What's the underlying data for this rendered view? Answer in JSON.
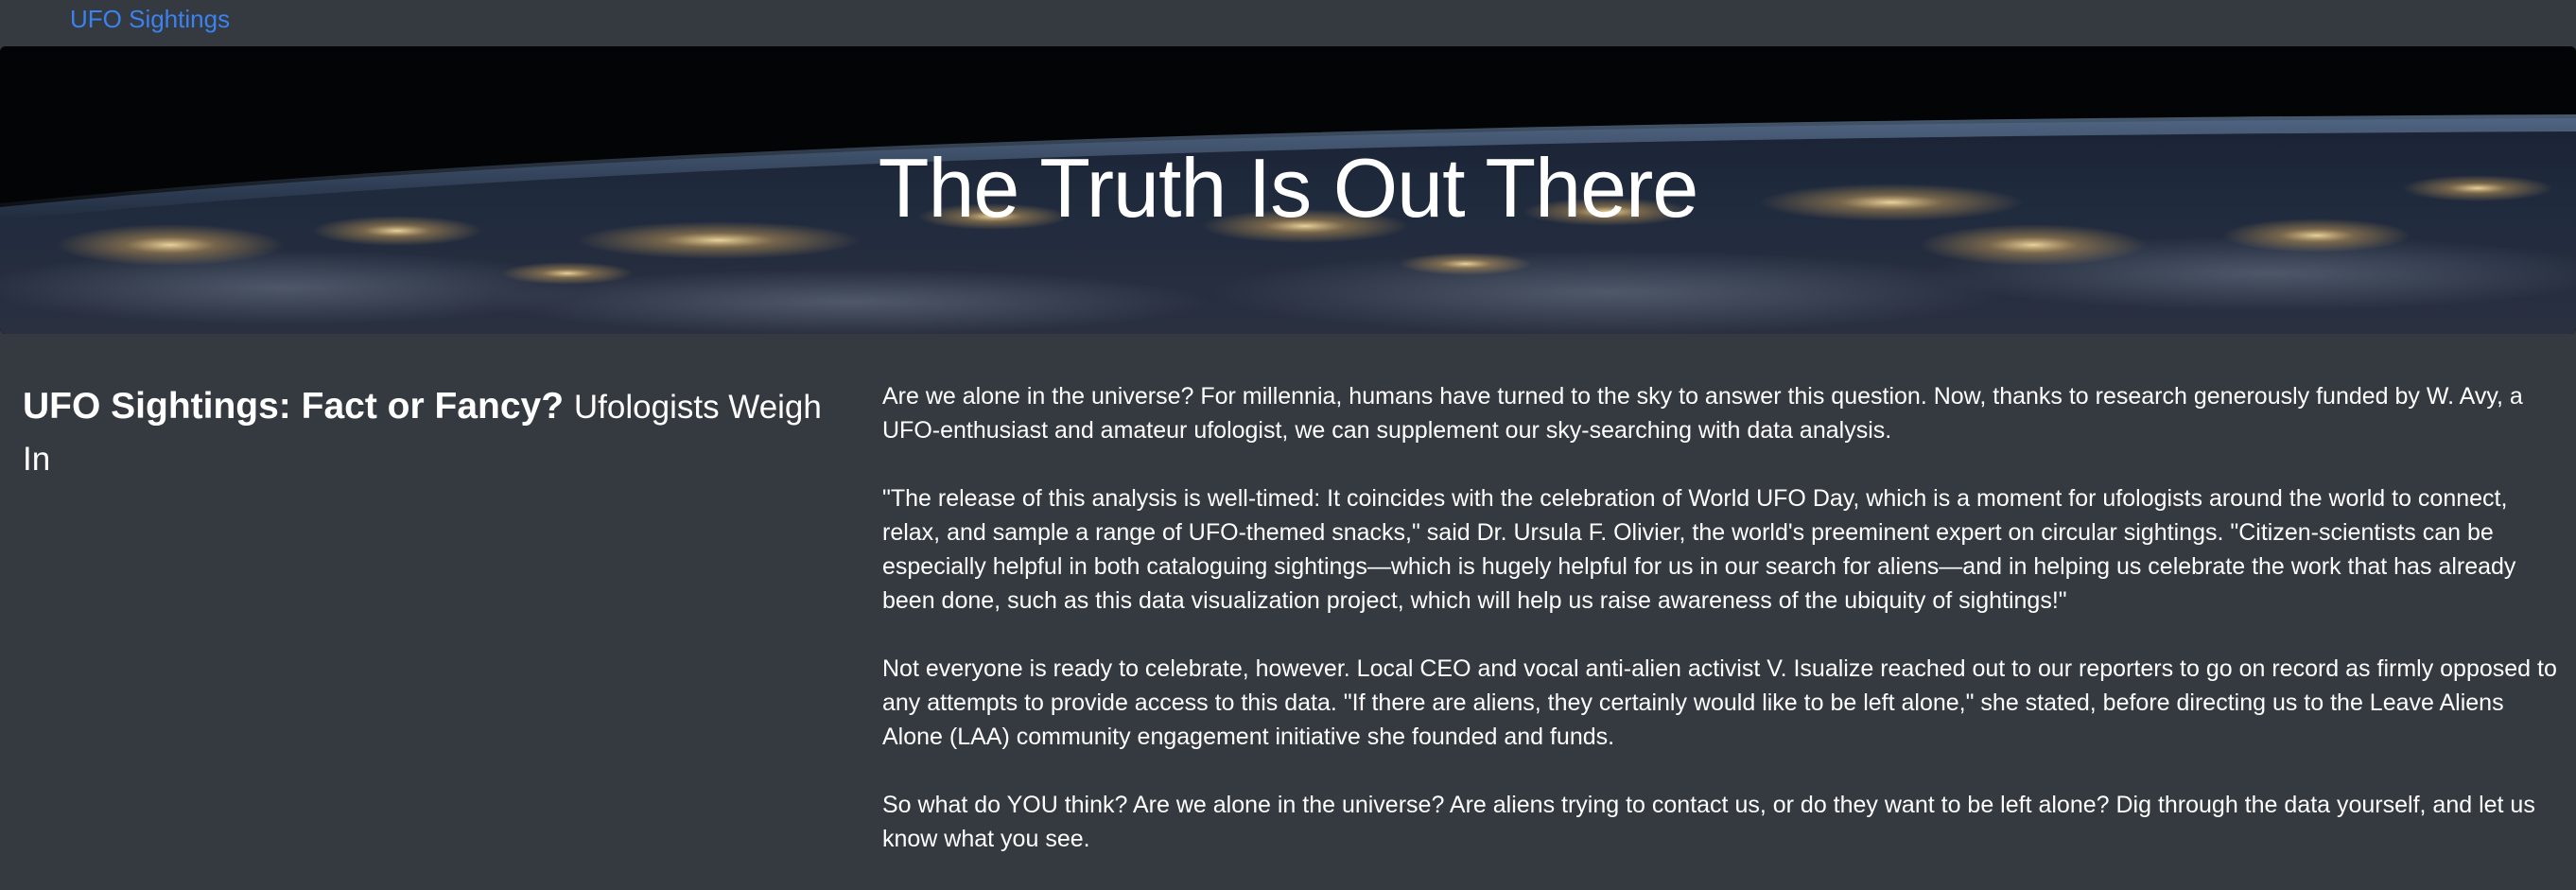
{
  "navbar": {
    "brand": "UFO Sightings"
  },
  "hero": {
    "title": "The Truth Is Out There"
  },
  "article": {
    "headline": "UFO Sightings: Fact or Fancy?",
    "subheadline": "Ufologists Weigh In",
    "paragraphs": [
      "Are we alone in the universe? For millennia, humans have turned to the sky to answer this question. Now, thanks to research generously funded by W. Avy, a UFO-enthusiast and amateur ufologist, we can supplement our sky-searching with data analysis.",
      "\"The release of this analysis is well-timed: It coincides with the celebration of World UFO Day, which is a moment for ufologists around the world to connect, relax, and sample a range of UFO-themed snacks,\" said Dr. Ursula F. Olivier, the world's preeminent expert on circular sightings. \"Citizen-scientists can be especially helpful in both cataloguing sightings—which is hugely helpful for us in our search for aliens—and in helping us celebrate the work that has already been done, such as this data visualization project, which will help us raise awareness of the ubiquity of sightings!\"",
      "Not everyone is ready to celebrate, however. Local CEO and vocal anti-alien activist V. Isualize reached out to our reporters to go on record as firmly opposed to any attempts to provide access to this data. \"If there are aliens, they certainly would like to be left alone,\" she stated, before directing us to the Leave Aliens Alone (LAA) community engagement initiative she founded and funds.",
      "So what do YOU think? Are we alone in the universe? Are aliens trying to contact us, or do they want to be left alone? Dig through the data yourself, and let us know what you see."
    ]
  },
  "colors": {
    "page_background": "#343a40",
    "brand_link": "#3b82f0",
    "text": "#ffffff"
  }
}
